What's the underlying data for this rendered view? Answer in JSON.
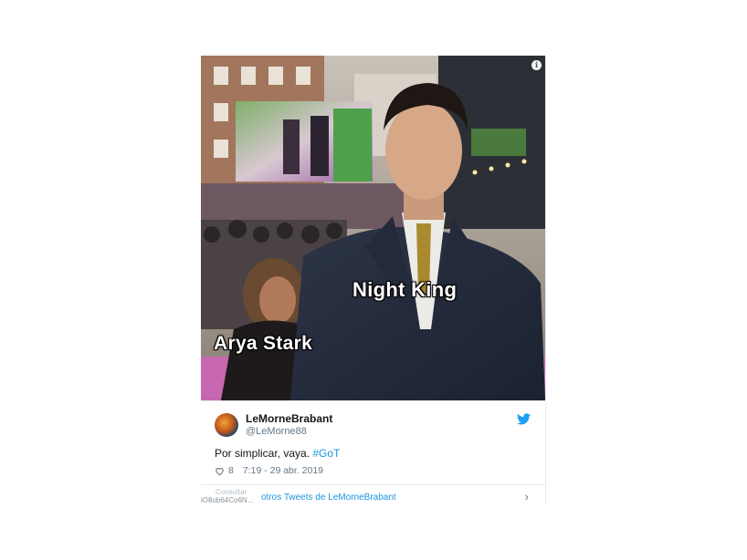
{
  "meme": {
    "label_front": "Night King",
    "label_back": "Arya Stark"
  },
  "tweet": {
    "display_name": "LeMorneBrabant",
    "handle": "@LeMorne88",
    "text_plain": "Por simplicar, vaya. ",
    "hashtag": "#GoT",
    "likes": "8",
    "timestamp": "7:19 - 29 abr. 2019",
    "footer_link": "otros Tweets de LeMorneBrabant",
    "footer_prefix": "Consultar",
    "footer_id": "iO8ob64Co6N..."
  },
  "icons": {
    "info": "info-icon",
    "twitter": "twitter-bird-icon",
    "like": "heart-icon",
    "more": "chevron-right-icon"
  },
  "colors": {
    "link": "#1b95e0",
    "text": "#14171a",
    "muted": "#657786"
  }
}
